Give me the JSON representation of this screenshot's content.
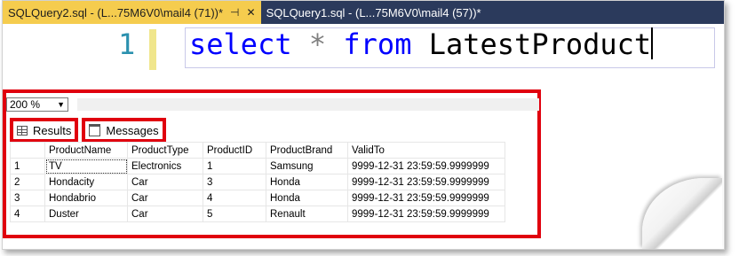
{
  "tabs": [
    {
      "label": "SQLQuery2.sql - (L...75M6V0\\mail4 (71))*",
      "pin": "⊣",
      "close": "✕"
    },
    {
      "label": "SQLQuery1.sql - (L...75M6V0\\mail4 (57))*"
    }
  ],
  "editor": {
    "line_number": "1",
    "tokens": {
      "select": "select",
      "star": "*",
      "from": "from",
      "table": "LatestProduct"
    }
  },
  "zoom": {
    "value": "200 %"
  },
  "result_tabs": {
    "results": "Results",
    "messages": "Messages"
  },
  "grid": {
    "columns": [
      "ProductName",
      "ProductType",
      "ProductID",
      "ProductBrand",
      "ValidTo"
    ],
    "rows": [
      {
        "n": "1",
        "cells": [
          "TV",
          "Electronics",
          "1",
          "Samsung",
          "9999-12-31 23:59:59.9999999"
        ]
      },
      {
        "n": "2",
        "cells": [
          "Hondacity",
          "Car",
          "3",
          "Honda",
          "9999-12-31 23:59:59.9999999"
        ]
      },
      {
        "n": "3",
        "cells": [
          "Hondabrio",
          "Car",
          "4",
          "Honda",
          "9999-12-31 23:59:59.9999999"
        ]
      },
      {
        "n": "4",
        "cells": [
          "Duster",
          "Car",
          "5",
          "Renault",
          "9999-12-31 23:59:59.9999999"
        ]
      }
    ]
  },
  "colors": {
    "active_tab": "#f5cc4e",
    "tabbar": "#2b3a5c",
    "keyword": "#0000ff",
    "highlight_border": "#e0000e"
  }
}
